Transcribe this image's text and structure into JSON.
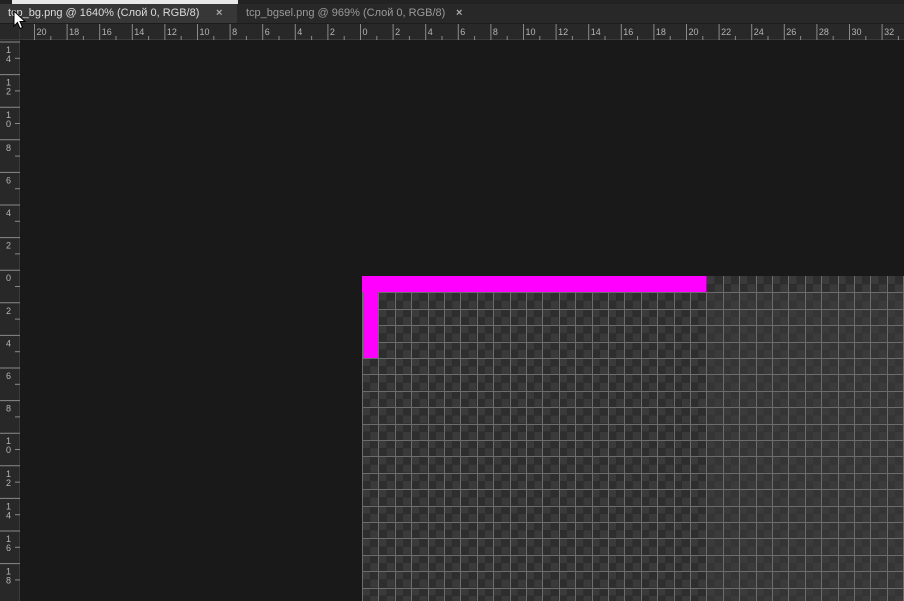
{
  "tabs": [
    {
      "label": "tcp_bg.png @ 1640% (Слой 0, RGB/8)",
      "close": "×",
      "active": true
    },
    {
      "label": "tcp_bgsel.png @ 969% (Слой 0, RGB/8)",
      "close": "×",
      "active": false
    }
  ],
  "horizontal_ruler": {
    "labels": [
      "20",
      "18",
      "16",
      "14",
      "12",
      "10",
      "8",
      "6",
      "4",
      "2",
      "0",
      "2",
      "4",
      "6",
      "8",
      "10",
      "12",
      "14",
      "16",
      "18",
      "20",
      "22",
      "24",
      "26",
      "28",
      "30",
      "32"
    ]
  },
  "vertical_ruler": {
    "labels": [
      "14",
      "12",
      "10",
      "8",
      "6",
      "4",
      "2",
      "0",
      "2",
      "4",
      "6",
      "8",
      "10",
      "12",
      "14",
      "16",
      "18"
    ]
  },
  "colors": {
    "ruler_bg": "#282828",
    "canvas_bg": "#191919",
    "magenta_pixels": "#ff00ff",
    "checker_dark": "#2e2e2e",
    "checker_light": "#3a3a3a",
    "pixel_grid": "#6c6c6c"
  },
  "icons": [
    "close-icon",
    "mouse-cursor-icon"
  ]
}
